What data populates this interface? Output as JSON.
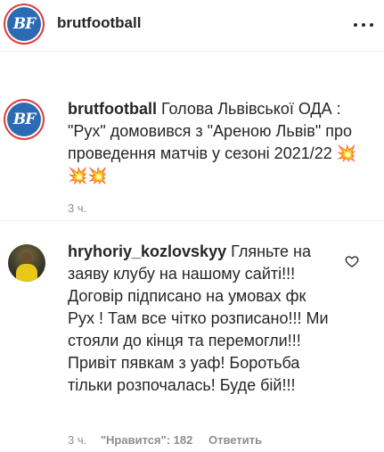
{
  "header": {
    "avatar_text": "BF",
    "username": "brutfootball",
    "more_icon": "more-horizontal-icon"
  },
  "caption": {
    "avatar_text": "BF",
    "username": "brutfootball",
    "text": "Голова Львівської ОДА : \"Рух\" домовився з \"Ареною Львів\" про проведення матчів у сезоні 2021/22",
    "emojis": "💥💥💥",
    "time": "3 ч."
  },
  "comment": {
    "username": "hryhoriy_kozlovskyy",
    "text": "Гляньте на заяву клубу на нашому сайті!!! Договір підписано на умовах фк Рух ! Там все чітко розписано!!! Ми стояли до кінця та перемогли!!! Привіт пявкам з уаф! Боротьба тільки розпочалась! Буде бій!!!",
    "time": "3 ч.",
    "likes_label": "\"Нравится\": 182",
    "reply_label": "Ответить",
    "heart_icon": "heart-outline-icon"
  },
  "colors": {
    "text": "#262626",
    "muted": "#8e8e8e",
    "avatar_ring": "#e23a3a",
    "avatar_bg": "#2a6bb3"
  }
}
